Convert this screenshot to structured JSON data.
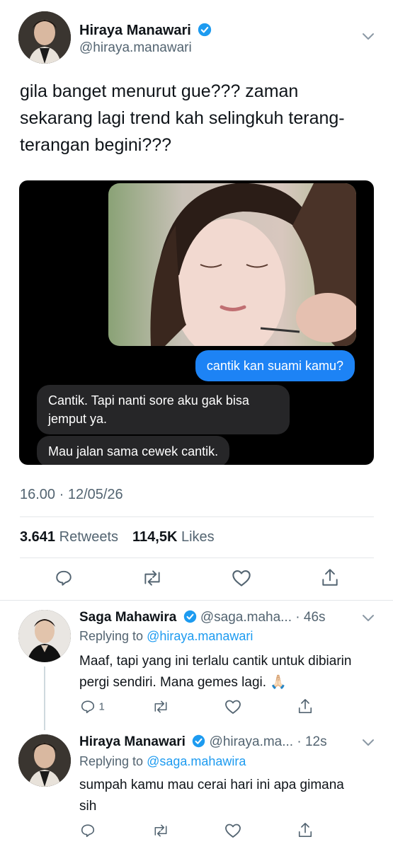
{
  "main_tweet": {
    "name": "Hiraya Manawari",
    "handle": "@hiraya.manawari",
    "text": "gila banget menurut gue??? zaman sekarang lagi trend kah selingkuh terang-terangan begini???",
    "chat": {
      "outgoing": "cantik kan suami kamu?",
      "incoming_1": "Cantik. Tapi nanti sore aku gak bisa jemput ya.",
      "incoming_2": "Mau jalan sama cewek cantik."
    },
    "timestamp": "16.00 · 12/05/26",
    "retweets_count": "3.641",
    "retweets_label": "Retweets",
    "likes_count": "114,5K",
    "likes_label": "Likes"
  },
  "replies": [
    {
      "name": "Saga Mahawira",
      "handle": "@saga.maha...",
      "time": "· 46s",
      "replying_prefix": "Replying to",
      "replying_to": "@hiraya.manawari",
      "text": "Maaf, tapi yang ini terlalu cantik untuk dibiarin pergi sendiri. Mana gemes lagi. 🙏🏻",
      "reply_count": "1"
    },
    {
      "name": "Hiraya Manawari",
      "handle": "@hiraya.ma...",
      "time": "· 12s",
      "replying_prefix": "Replying to",
      "replying_to": "@saga.mahawira",
      "text": "sumpah kamu mau cerai hari ini apa gimana sih",
      "reply_count": ""
    }
  ],
  "icons": {
    "verified": "verified-badge-icon",
    "chevron": "chevron-down-icon",
    "reply": "reply-icon",
    "retweet": "retweet-icon",
    "like": "heart-icon",
    "share": "share-icon"
  },
  "colors": {
    "accent": "#1d9bf0",
    "chat_outgoing": "#1d83f5",
    "chat_incoming": "#262628",
    "muted": "#536471"
  }
}
